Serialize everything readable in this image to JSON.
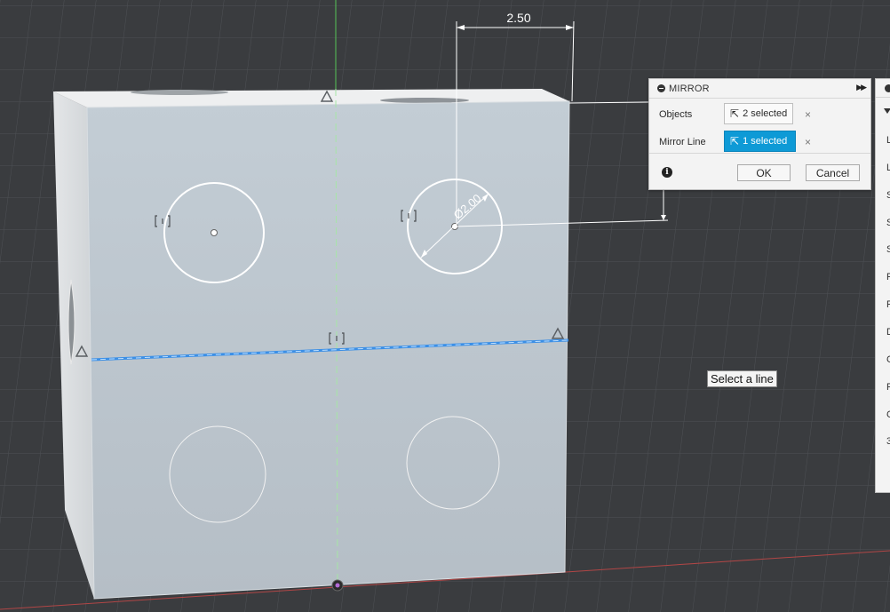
{
  "viewport": {
    "dimension_label": "2.50",
    "diameter_label": "Ø2.00"
  },
  "mirror_dialog": {
    "title": "MIRROR",
    "objects_label": "Objects",
    "objects_value": "2 selected",
    "mirror_line_label": "Mirror Line",
    "mirror_line_value": "1 selected",
    "clear_symbol": "×",
    "ok_label": "OK",
    "cancel_label": "Cancel",
    "info_symbol": "i"
  },
  "tooltip": "Select a line",
  "side_panel": {
    "letters": [
      "L",
      "L",
      "S",
      "S",
      "S",
      "P",
      "P",
      "D",
      "C",
      "P",
      "C",
      "3"
    ]
  }
}
